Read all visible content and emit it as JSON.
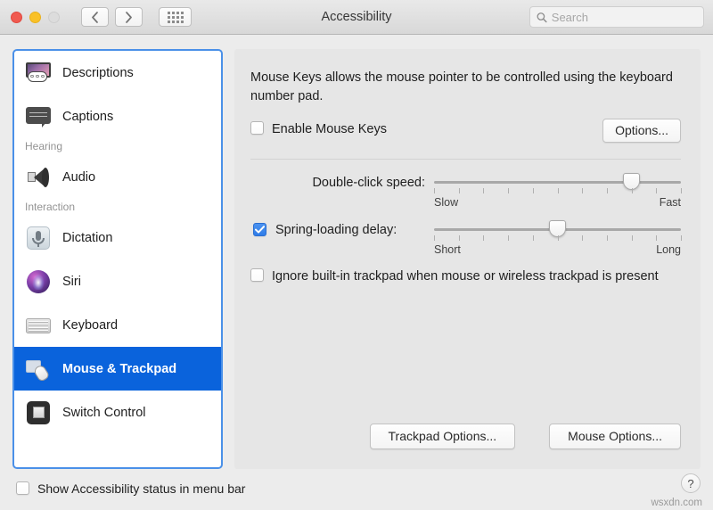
{
  "window": {
    "title": "Accessibility",
    "traffic_lights": [
      "close",
      "minimize",
      "zoom"
    ],
    "nav_back_label": "‹",
    "nav_forward_label": "›",
    "grid_button_label": "show-all"
  },
  "search": {
    "placeholder": "Search",
    "value": ""
  },
  "sidebar": {
    "items": [
      {
        "label": "Descriptions",
        "icon": "descriptions-icon",
        "type": "item",
        "selected": false
      },
      {
        "label": "Captions",
        "icon": "captions-icon",
        "type": "item",
        "selected": false
      },
      {
        "label": "Hearing",
        "type": "group"
      },
      {
        "label": "Audio",
        "icon": "audio-icon",
        "type": "item",
        "selected": false
      },
      {
        "label": "Interaction",
        "type": "group"
      },
      {
        "label": "Dictation",
        "icon": "dictation-icon",
        "type": "item",
        "selected": false
      },
      {
        "label": "Siri",
        "icon": "siri-icon",
        "type": "item",
        "selected": false
      },
      {
        "label": "Keyboard",
        "icon": "keyboard-icon",
        "type": "item",
        "selected": false
      },
      {
        "label": "Mouse & Trackpad",
        "icon": "mouse-trackpad-icon",
        "type": "item",
        "selected": true
      },
      {
        "label": "Switch Control",
        "icon": "switch-control-icon",
        "type": "item",
        "selected": false
      }
    ]
  },
  "main": {
    "description": "Mouse Keys allows the mouse pointer to be controlled using the keyboard number pad.",
    "enable_mouse_keys": {
      "label": "Enable Mouse Keys",
      "checked": false
    },
    "options_button": "Options...",
    "sliders": [
      {
        "label": "Double-click speed:",
        "has_checkbox": false,
        "checked": false,
        "min_label": "Slow",
        "max_label": "Fast",
        "tick_count": 11,
        "value": 8,
        "max_value": 10,
        "percent": 80
      },
      {
        "label": "Spring-loading delay:",
        "has_checkbox": true,
        "checked": true,
        "min_label": "Short",
        "max_label": "Long",
        "tick_count": 11,
        "value": 5,
        "max_value": 10,
        "percent": 50
      }
    ],
    "ignore_trackpad": {
      "label": "Ignore built-in trackpad when mouse or wireless trackpad is present",
      "checked": false
    },
    "trackpad_options_button": "Trackpad Options...",
    "mouse_options_button": "Mouse Options..."
  },
  "footer": {
    "show_status": {
      "label": "Show Accessibility status in menu bar",
      "checked": false
    },
    "help_label": "?",
    "watermark": "wsxdn.com"
  },
  "colors": {
    "accent": "#0a63dc",
    "checkbox_checked": "#2f7ce8",
    "focus_border": "#4a90e8",
    "window_bg": "#ececec",
    "panel_bg": "#e6e6e6"
  }
}
